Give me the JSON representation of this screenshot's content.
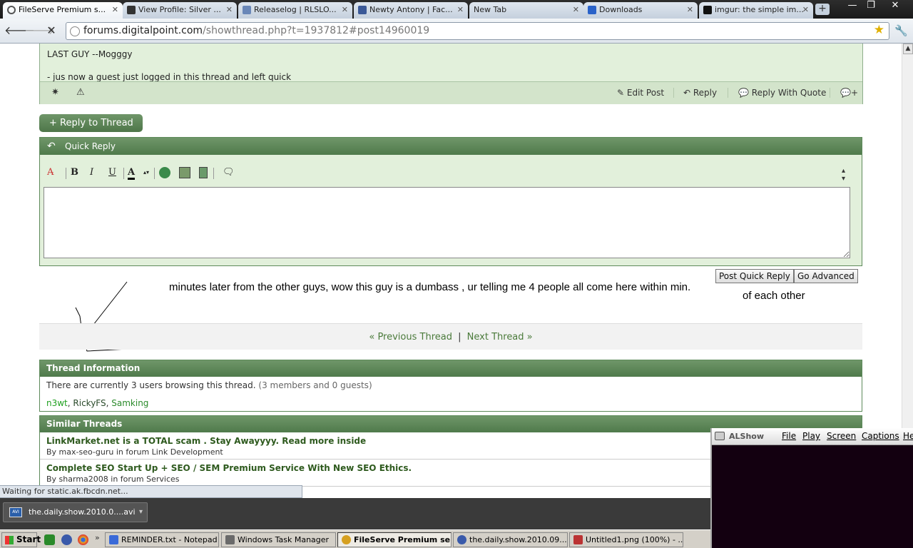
{
  "tabs": [
    {
      "title": "FileServe Premium s...",
      "active": true
    },
    {
      "title": "View Profile: Silver ..."
    },
    {
      "title": "Releaselog | RLSLO..."
    },
    {
      "title": "Newty Antony | Fac..."
    },
    {
      "title": "New Tab"
    },
    {
      "title": "Downloads"
    },
    {
      "title": "imgur: the simple im..."
    }
  ],
  "toolbar": {
    "url_host": "forums.digitalpoint.com",
    "url_path": "/showthread.php?t=1937812#post14960019"
  },
  "post": {
    "line1": "LAST GUY --Mogggy",
    "line2": "- jus now a guest just logged in this thread and left quick",
    "actions": {
      "edit": "Edit Post",
      "reply": "Reply",
      "reply_quote": "Reply With Quote"
    }
  },
  "reply_to_thread": "+ Reply to Thread",
  "quick_reply": {
    "title": "Quick Reply",
    "editor_value": "",
    "post_button": "Post Quick Reply",
    "advanced_button": "Go Advanced"
  },
  "annotation": {
    "text1": "minutes later from the other guys, wow this guy is a dumbass , ur telling me 4 people all come here within min.",
    "text2": "of each other"
  },
  "thread_nav": {
    "prev": "« Previous Thread",
    "separator": "|",
    "next": "Next Thread »"
  },
  "thread_info": {
    "title": "Thread Information",
    "browsing": "There are currently 3 users browsing this thread.",
    "counts": "(3 members and 0 guests)",
    "users": [
      "n3wt",
      "RickyFS",
      "Samking"
    ]
  },
  "similar_threads": {
    "title": "Similar Threads",
    "items": [
      {
        "title": "LinkMarket.net is a TOTAL scam . Stay Awayyyy. Read more inside",
        "by": "By max-seo-guru in forum Link Development"
      },
      {
        "title": "Complete SEO Start Up + SEO / SEM Premium Service With New SEO Ethics.",
        "by": "By sharma2008 in forum Services"
      }
    ]
  },
  "status": "Waiting for static.ak.fbcdn.net...",
  "download": {
    "filename": "the.daily.show.2010.0....avi",
    "icon_text": "AVI"
  },
  "taskbar": {
    "start": "Start",
    "items": [
      {
        "label": "REMINDER.txt - Notepad"
      },
      {
        "label": "Windows Task Manager"
      },
      {
        "label": "FileServe Premium se...",
        "active": true
      },
      {
        "label": "the.daily.show.2010.09...."
      },
      {
        "label": "Untitled1.png (100%) - ..."
      }
    ]
  },
  "alshow": {
    "name": "ALShow",
    "menu": [
      "File",
      "Play",
      "Screen",
      "Captions",
      "He"
    ]
  },
  "colors": {
    "forum_green": "#5e8a5b",
    "post_bg": "#e2f0db",
    "link_green": "#2e5a1e",
    "user_green": "#1fa01f"
  }
}
